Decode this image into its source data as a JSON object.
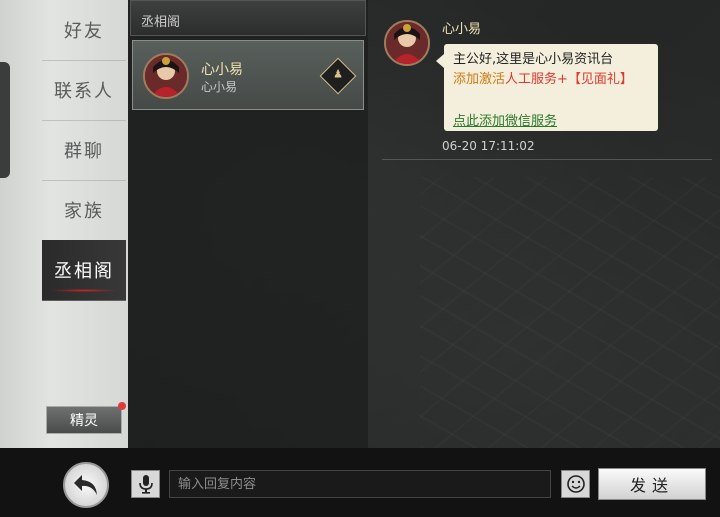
{
  "tabs": [
    {
      "label": "好友",
      "active": false
    },
    {
      "label": "联系人",
      "active": false
    },
    {
      "label": "群聊",
      "active": false
    },
    {
      "label": "家族",
      "active": false
    },
    {
      "label": "丞相阁",
      "active": true
    }
  ],
  "spirit_button": {
    "label": "精灵",
    "has_notification": true
  },
  "list": {
    "header": "丞相阁",
    "contacts": [
      {
        "name": "心小易",
        "subtitle": "心小易",
        "badge_icon": "person-diamond-icon"
      }
    ]
  },
  "chat": {
    "sender": "心小易",
    "message": {
      "line1": "主公好,这里是心小易资讯台",
      "line2_prefix": "添加激活",
      "line2_highlight": "人工服务+【见面礼】",
      "link_text": "点此添加微信服务"
    },
    "timestamp": "06-20 17:11:02"
  },
  "bottom_bar": {
    "input_placeholder": "输入回复内容",
    "send_label": "发送"
  },
  "colors": {
    "accent_red": "#e02020",
    "name_gold": "#f1e2b0",
    "link_green": "#2a7a2a",
    "highlight_orange": "#d07a12",
    "highlight_red": "#e0382f"
  }
}
